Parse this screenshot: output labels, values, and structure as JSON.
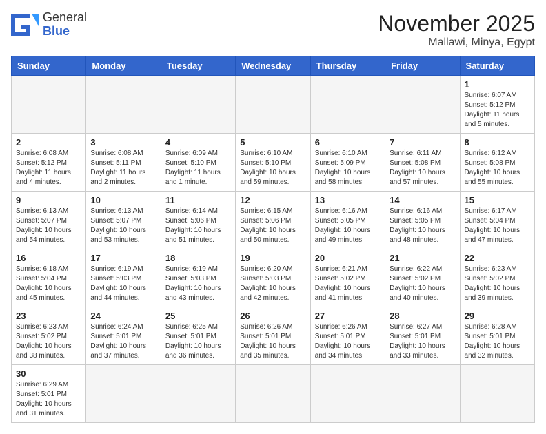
{
  "logo": {
    "line1": "General",
    "line2": "Blue"
  },
  "title": "November 2025",
  "location": "Mallawi, Minya, Egypt",
  "days_of_week": [
    "Sunday",
    "Monday",
    "Tuesday",
    "Wednesday",
    "Thursday",
    "Friday",
    "Saturday"
  ],
  "weeks": [
    [
      {
        "day": "",
        "info": ""
      },
      {
        "day": "",
        "info": ""
      },
      {
        "day": "",
        "info": ""
      },
      {
        "day": "",
        "info": ""
      },
      {
        "day": "",
        "info": ""
      },
      {
        "day": "",
        "info": ""
      },
      {
        "day": "1",
        "info": "Sunrise: 6:07 AM\nSunset: 5:12 PM\nDaylight: 11 hours and 5 minutes."
      }
    ],
    [
      {
        "day": "2",
        "info": "Sunrise: 6:08 AM\nSunset: 5:12 PM\nDaylight: 11 hours and 4 minutes."
      },
      {
        "day": "3",
        "info": "Sunrise: 6:08 AM\nSunset: 5:11 PM\nDaylight: 11 hours and 2 minutes."
      },
      {
        "day": "4",
        "info": "Sunrise: 6:09 AM\nSunset: 5:10 PM\nDaylight: 11 hours and 1 minute."
      },
      {
        "day": "5",
        "info": "Sunrise: 6:10 AM\nSunset: 5:10 PM\nDaylight: 10 hours and 59 minutes."
      },
      {
        "day": "6",
        "info": "Sunrise: 6:10 AM\nSunset: 5:09 PM\nDaylight: 10 hours and 58 minutes."
      },
      {
        "day": "7",
        "info": "Sunrise: 6:11 AM\nSunset: 5:08 PM\nDaylight: 10 hours and 57 minutes."
      },
      {
        "day": "8",
        "info": "Sunrise: 6:12 AM\nSunset: 5:08 PM\nDaylight: 10 hours and 55 minutes."
      }
    ],
    [
      {
        "day": "9",
        "info": "Sunrise: 6:13 AM\nSunset: 5:07 PM\nDaylight: 10 hours and 54 minutes."
      },
      {
        "day": "10",
        "info": "Sunrise: 6:13 AM\nSunset: 5:07 PM\nDaylight: 10 hours and 53 minutes."
      },
      {
        "day": "11",
        "info": "Sunrise: 6:14 AM\nSunset: 5:06 PM\nDaylight: 10 hours and 51 minutes."
      },
      {
        "day": "12",
        "info": "Sunrise: 6:15 AM\nSunset: 5:06 PM\nDaylight: 10 hours and 50 minutes."
      },
      {
        "day": "13",
        "info": "Sunrise: 6:16 AM\nSunset: 5:05 PM\nDaylight: 10 hours and 49 minutes."
      },
      {
        "day": "14",
        "info": "Sunrise: 6:16 AM\nSunset: 5:05 PM\nDaylight: 10 hours and 48 minutes."
      },
      {
        "day": "15",
        "info": "Sunrise: 6:17 AM\nSunset: 5:04 PM\nDaylight: 10 hours and 47 minutes."
      }
    ],
    [
      {
        "day": "16",
        "info": "Sunrise: 6:18 AM\nSunset: 5:04 PM\nDaylight: 10 hours and 45 minutes."
      },
      {
        "day": "17",
        "info": "Sunrise: 6:19 AM\nSunset: 5:03 PM\nDaylight: 10 hours and 44 minutes."
      },
      {
        "day": "18",
        "info": "Sunrise: 6:19 AM\nSunset: 5:03 PM\nDaylight: 10 hours and 43 minutes."
      },
      {
        "day": "19",
        "info": "Sunrise: 6:20 AM\nSunset: 5:03 PM\nDaylight: 10 hours and 42 minutes."
      },
      {
        "day": "20",
        "info": "Sunrise: 6:21 AM\nSunset: 5:02 PM\nDaylight: 10 hours and 41 minutes."
      },
      {
        "day": "21",
        "info": "Sunrise: 6:22 AM\nSunset: 5:02 PM\nDaylight: 10 hours and 40 minutes."
      },
      {
        "day": "22",
        "info": "Sunrise: 6:23 AM\nSunset: 5:02 PM\nDaylight: 10 hours and 39 minutes."
      }
    ],
    [
      {
        "day": "23",
        "info": "Sunrise: 6:23 AM\nSunset: 5:02 PM\nDaylight: 10 hours and 38 minutes."
      },
      {
        "day": "24",
        "info": "Sunrise: 6:24 AM\nSunset: 5:01 PM\nDaylight: 10 hours and 37 minutes."
      },
      {
        "day": "25",
        "info": "Sunrise: 6:25 AM\nSunset: 5:01 PM\nDaylight: 10 hours and 36 minutes."
      },
      {
        "day": "26",
        "info": "Sunrise: 6:26 AM\nSunset: 5:01 PM\nDaylight: 10 hours and 35 minutes."
      },
      {
        "day": "27",
        "info": "Sunrise: 6:26 AM\nSunset: 5:01 PM\nDaylight: 10 hours and 34 minutes."
      },
      {
        "day": "28",
        "info": "Sunrise: 6:27 AM\nSunset: 5:01 PM\nDaylight: 10 hours and 33 minutes."
      },
      {
        "day": "29",
        "info": "Sunrise: 6:28 AM\nSunset: 5:01 PM\nDaylight: 10 hours and 32 minutes."
      }
    ],
    [
      {
        "day": "30",
        "info": "Sunrise: 6:29 AM\nSunset: 5:01 PM\nDaylight: 10 hours and 31 minutes."
      },
      {
        "day": "",
        "info": ""
      },
      {
        "day": "",
        "info": ""
      },
      {
        "day": "",
        "info": ""
      },
      {
        "day": "",
        "info": ""
      },
      {
        "day": "",
        "info": ""
      },
      {
        "day": "",
        "info": ""
      }
    ]
  ]
}
